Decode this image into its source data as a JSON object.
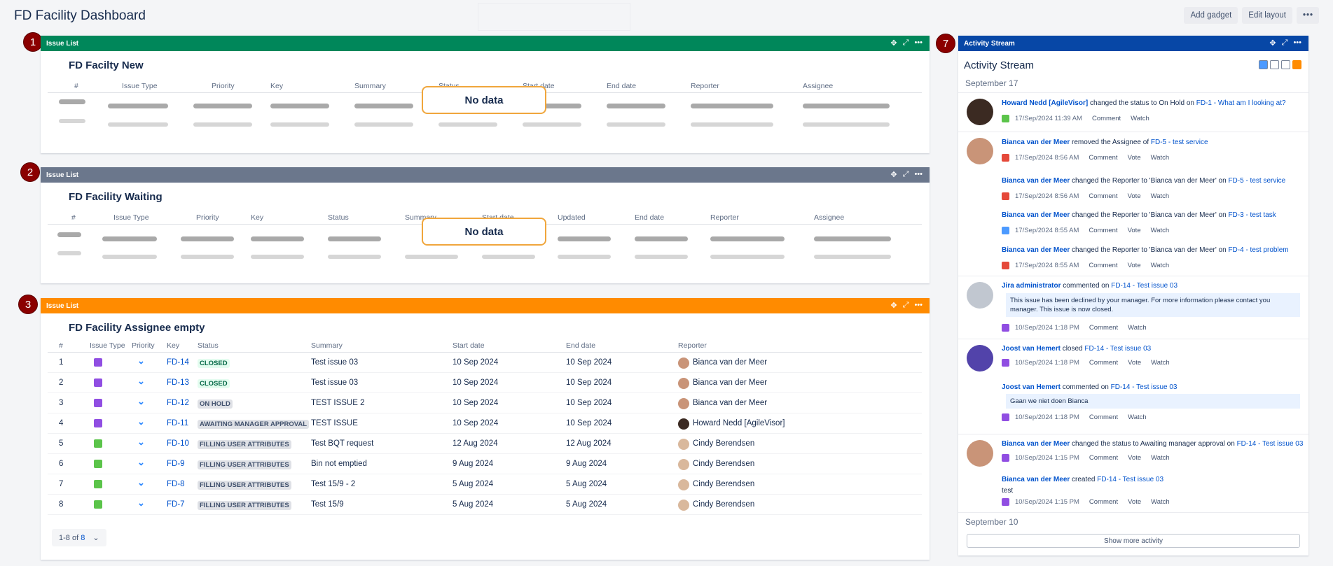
{
  "page": {
    "title": "FD Facility Dashboard",
    "add_gadget": "Add gadget",
    "edit_layout": "Edit layout",
    "more": "•••"
  },
  "badges": [
    "1",
    "2",
    "3",
    "7"
  ],
  "colors": {
    "green": "#00875a",
    "grey": "#6b778c",
    "orange": "#ff8b00",
    "blue": "#0747a6"
  },
  "gadget1": {
    "header": "Issue List",
    "title": "FD Facilty New",
    "no_data": "No data",
    "columns": [
      "#",
      "Issue Type",
      "Priority",
      "Key",
      "Summary",
      "Status",
      "Start date",
      "End date",
      "Reporter",
      "Assignee"
    ]
  },
  "gadget2": {
    "header": "Issue List",
    "title": "FD Facility Waiting",
    "no_data": "No data",
    "columns": [
      "#",
      "Issue Type",
      "Priority",
      "Key",
      "Status",
      "Summary",
      "Start date",
      "Updated",
      "End date",
      "Reporter",
      "Assignee"
    ]
  },
  "gadget3": {
    "header": "Issue List",
    "title": "FD Facility Assignee empty",
    "columns": [
      "#",
      "Issue Type",
      "Priority",
      "Key",
      "Status",
      "Summary",
      "Start date",
      "End date",
      "Reporter"
    ],
    "rows": [
      {
        "n": "1",
        "key": "FD-14",
        "status": "CLOSED",
        "summary": "Test issue 03",
        "start": "10 Sep 2024",
        "end": "10 Sep 2024",
        "reporter": "Bianca van der Meer"
      },
      {
        "n": "2",
        "key": "FD-13",
        "status": "CLOSED",
        "summary": "Test issue 03",
        "start": "10 Sep 2024",
        "end": "10 Sep 2024",
        "reporter": "Bianca van der Meer"
      },
      {
        "n": "3",
        "key": "FD-12",
        "status": "ON HOLD",
        "summary": "TEST ISSUE 2",
        "start": "10 Sep 2024",
        "end": "10 Sep 2024",
        "reporter": "Bianca van der Meer"
      },
      {
        "n": "4",
        "key": "FD-11",
        "status": "AWAITING MANAGER APPROVAL",
        "summary": "TEST ISSUE",
        "start": "10 Sep 2024",
        "end": "10 Sep 2024",
        "reporter": "Howard Nedd [AgileVisor]"
      },
      {
        "n": "5",
        "key": "FD-10",
        "status": "FILLING USER ATTRIBUTES",
        "summary": "Test BQT request",
        "start": "12 Aug 2024",
        "end": "12 Aug 2024",
        "reporter": "Cindy Berendsen"
      },
      {
        "n": "6",
        "key": "FD-9",
        "status": "FILLING USER ATTRIBUTES",
        "summary": "Bin not emptied",
        "start": "9 Aug 2024",
        "end": "9 Aug 2024",
        "reporter": "Cindy Berendsen"
      },
      {
        "n": "7",
        "key": "FD-8",
        "status": "FILLING USER ATTRIBUTES",
        "summary": "Test 15/9 - 2",
        "start": "5 Aug 2024",
        "end": "5 Aug 2024",
        "reporter": "Cindy Berendsen"
      },
      {
        "n": "8",
        "key": "FD-7",
        "status": "FILLING USER ATTRIBUTES",
        "summary": "Test 15/9",
        "start": "5 Aug 2024",
        "end": "5 Aug 2024",
        "reporter": "Cindy Berendsen"
      }
    ],
    "pager_prefix": "1-8 of",
    "pager_total": "8"
  },
  "activity": {
    "header": "Activity Stream",
    "title": "Activity Stream",
    "date1": "September 17",
    "date2": "September 10",
    "comment": "Comment",
    "vote": "Vote",
    "watch": "Watch",
    "e1": {
      "who": "Howard Nedd [AgileVisor]",
      "text": " changed the status to On Hold on ",
      "link": "FD-1 - What am I looking at?",
      "time": "17/Sep/2024 11:39 AM"
    },
    "e2": {
      "who": "Bianca van der Meer",
      "text": " removed the Assignee of ",
      "link": "FD-5 - test service",
      "time": "17/Sep/2024 8:56 AM"
    },
    "e3": {
      "who": "Bianca van der Meer",
      "text": " changed the Reporter to 'Bianca van der Meer' on ",
      "link": "FD-5 - test service",
      "time": "17/Sep/2024 8:56 AM"
    },
    "e4": {
      "who": "Bianca van der Meer",
      "text": " changed the Reporter to 'Bianca van der Meer' on ",
      "link": "FD-3 - test task",
      "time": "17/Sep/2024 8:55 AM"
    },
    "e5": {
      "who": "Bianca van der Meer",
      "text": " changed the Reporter to 'Bianca van der Meer' on ",
      "link": "FD-4 - test problem",
      "time": "17/Sep/2024 8:55 AM"
    },
    "e6": {
      "who": "Jira administrator",
      "text": " commented on ",
      "link": "FD-14 - Test issue 03",
      "quote": "This issue has been declined by your manager. For more information please contact you manager. This issue is now closed.",
      "time": "10/Sep/2024 1:18 PM"
    },
    "e7": {
      "who": "Joost van Hemert",
      "text": " closed ",
      "link": "FD-14 - Test issue 03",
      "time": "10/Sep/2024 1:18 PM"
    },
    "e8": {
      "who": "Joost van Hemert",
      "text": " commented on ",
      "link": "FD-14 - Test issue 03",
      "quote": "Gaan we niet doen Bianca",
      "time": "10/Sep/2024 1:18 PM"
    },
    "e9": {
      "who": "Bianca van der Meer",
      "text": " changed the status to Awaiting manager approval on ",
      "link": "FD-14 - Test issue 03",
      "time": "10/Sep/2024 1:15 PM"
    },
    "e10": {
      "who": "Bianca van der Meer",
      "text": " created ",
      "link": "FD-14 - Test issue 03",
      "body": "test",
      "time": "10/Sep/2024 1:15 PM"
    },
    "show_more": "Show more activity"
  }
}
